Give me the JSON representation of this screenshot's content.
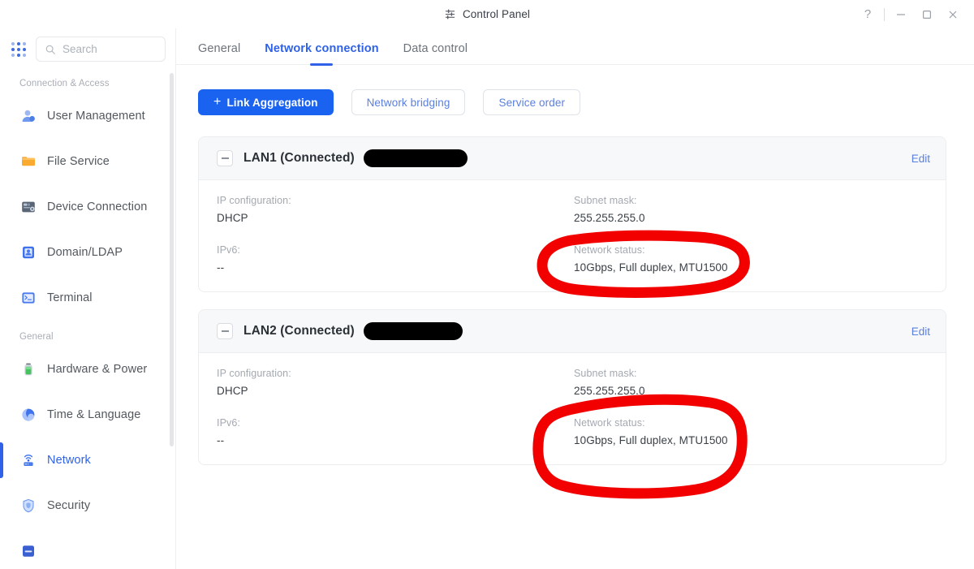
{
  "window": {
    "title": "Control Panel",
    "title_icon": "sliders-icon",
    "controls": {
      "help": "?",
      "minimize": "minimize-icon",
      "maximize": "maximize-icon",
      "close": "close-icon"
    }
  },
  "sidebar": {
    "apps_icon": "app-grid-icon",
    "search": {
      "placeholder": "Search",
      "value": "",
      "icon": "search-icon"
    },
    "groups": [
      {
        "label": "Connection & Access",
        "items": [
          {
            "label": "User Management",
            "icon": "user-icon",
            "active": false
          },
          {
            "label": "File Service",
            "icon": "folder-icon",
            "active": false
          },
          {
            "label": "Device Connection",
            "icon": "device-icon",
            "active": false
          },
          {
            "label": "Domain/LDAP",
            "icon": "domain-icon",
            "active": false
          },
          {
            "label": "Terminal",
            "icon": "terminal-icon",
            "active": false
          }
        ]
      },
      {
        "label": "General",
        "items": [
          {
            "label": "Hardware & Power",
            "icon": "battery-icon",
            "active": false
          },
          {
            "label": "Time & Language",
            "icon": "globe-icon",
            "active": false
          },
          {
            "label": "Network",
            "icon": "network-icon",
            "active": true
          },
          {
            "label": "Security",
            "icon": "shield-icon",
            "active": false
          }
        ]
      }
    ]
  },
  "main": {
    "tabs": [
      {
        "label": "General",
        "active": false
      },
      {
        "label": "Network connection",
        "active": true
      },
      {
        "label": "Data control",
        "active": false
      }
    ],
    "toolbar": {
      "link_aggregation": "Link Aggregation",
      "link_aggregation_plus": "+",
      "network_bridging": "Network bridging",
      "service_order": "Service order"
    },
    "interfaces": [
      {
        "title": "LAN1 (Connected)",
        "redacted": true,
        "edit_label": "Edit",
        "fields": {
          "ip_configuration_label": "IP configuration:",
          "ip_configuration_value": "DHCP",
          "subnet_mask_label": "Subnet mask:",
          "subnet_mask_value": "255.255.255.0",
          "ipv6_label": "IPv6:",
          "ipv6_value": "--",
          "network_status_label": "Network status:",
          "network_status_value": "10Gbps,  Full duplex,  MTU1500"
        }
      },
      {
        "title": "LAN2 (Connected)",
        "redacted": true,
        "edit_label": "Edit",
        "fields": {
          "ip_configuration_label": "IP configuration:",
          "ip_configuration_value": "DHCP",
          "subnet_mask_label": "Subnet mask:",
          "subnet_mask_value": "255.255.255.0",
          "ipv6_label": "IPv6:",
          "ipv6_value": "--",
          "network_status_label": "Network status:",
          "network_status_value": "10Gbps,  Full duplex,  MTU1500"
        }
      }
    ]
  },
  "annotations": {
    "color": "#f20000",
    "shapes": [
      {
        "name": "circle-lan1-network-status"
      },
      {
        "name": "circle-lan2-network-status"
      }
    ]
  },
  "colors": {
    "accent": "#2f62e8",
    "primary_button": "#1a62f0",
    "link": "#5b7fdd",
    "annotation_red": "#f20000",
    "card_header": "#f7f8f9"
  }
}
